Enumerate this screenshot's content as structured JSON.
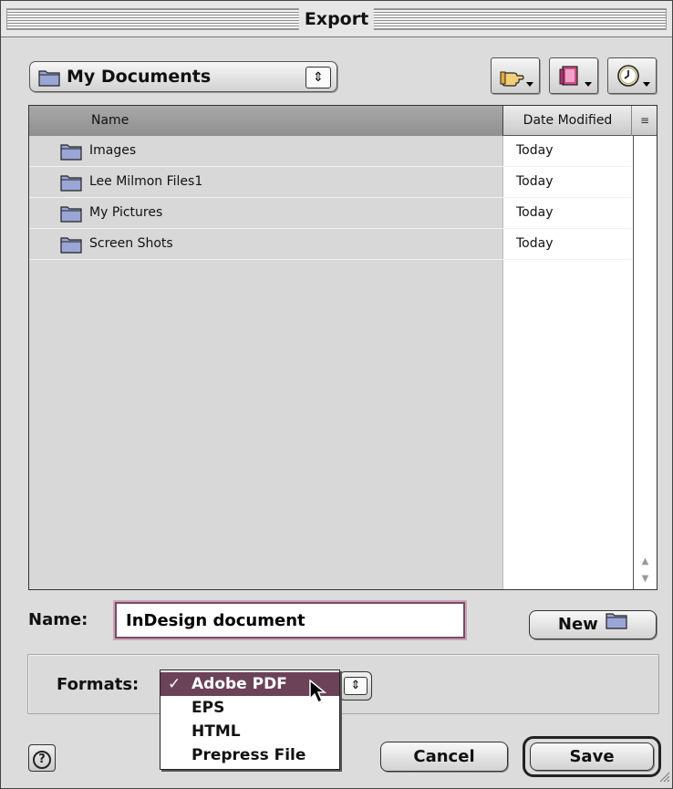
{
  "window": {
    "title": "Export"
  },
  "location": {
    "label": "My Documents",
    "arrows": "⬍"
  },
  "shortcuts": [
    {
      "name": "shortcuts-icon"
    },
    {
      "name": "favorites-icon"
    },
    {
      "name": "recent-icon"
    }
  ],
  "list": {
    "header_name": "Name",
    "header_date": "Date Modified",
    "sort_glyph": "≡",
    "rows": [
      {
        "name": "Images",
        "date": "Today"
      },
      {
        "name": "Lee Milmon Files1",
        "date": "Today"
      },
      {
        "name": "My Pictures",
        "date": "Today"
      },
      {
        "name": "Screen Shots",
        "date": "Today"
      }
    ]
  },
  "name_field": {
    "label": "Name:",
    "value": "InDesign document"
  },
  "new_button": {
    "label": "New"
  },
  "formats": {
    "label": "Formats:",
    "selected": "Adobe PDF",
    "options": [
      "Adobe PDF",
      "EPS",
      "HTML",
      "Prepress File"
    ]
  },
  "buttons": {
    "help": "?",
    "cancel": "Cancel",
    "save": "Save"
  },
  "colors": {
    "selection": "#6b4258",
    "focus_ring": "#7a4c63",
    "window_bg": "#dcdcdc"
  }
}
